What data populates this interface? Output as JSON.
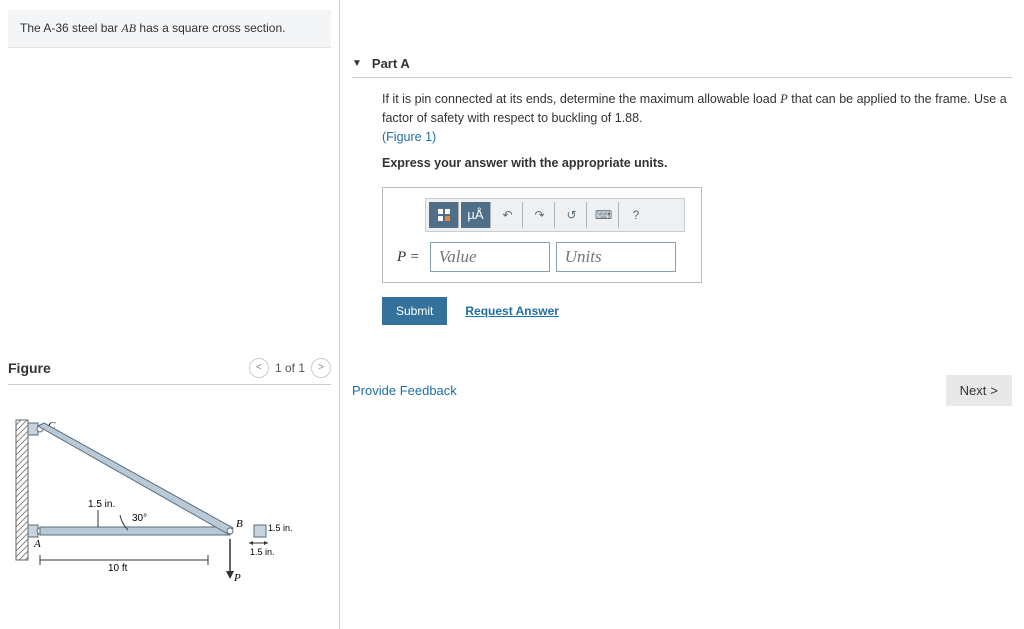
{
  "problem": {
    "prefix": "The A-36 steel bar ",
    "bar": "AB",
    "suffix": " has a square cross section."
  },
  "figure": {
    "title": "Figure",
    "pager": "1 of 1",
    "labels": {
      "C": "C",
      "A": "A",
      "B": "B",
      "P": "P",
      "len": "10 ft",
      "h": "1.5 in.",
      "ang": "30°",
      "s1": "1.5 in.",
      "s2": "1.5 in."
    }
  },
  "partA": {
    "title": "Part A",
    "text1a": "If it is pin connected at its ends, determine the maximum allowable load ",
    "pvar": "P",
    "text1b": " that can be applied to the frame. Use a factor of safety with respect to buckling of 1.88.",
    "figlink": "(Figure 1)",
    "instruction": "Express your answer with the appropriate units.",
    "toolbar": {
      "units": "µÅ",
      "help": "?"
    },
    "eq": "P =",
    "value_ph": "Value",
    "units_ph": "Units",
    "submit": "Submit",
    "request": "Request Answer"
  },
  "footer": {
    "feedback": "Provide Feedback",
    "next": "Next"
  }
}
